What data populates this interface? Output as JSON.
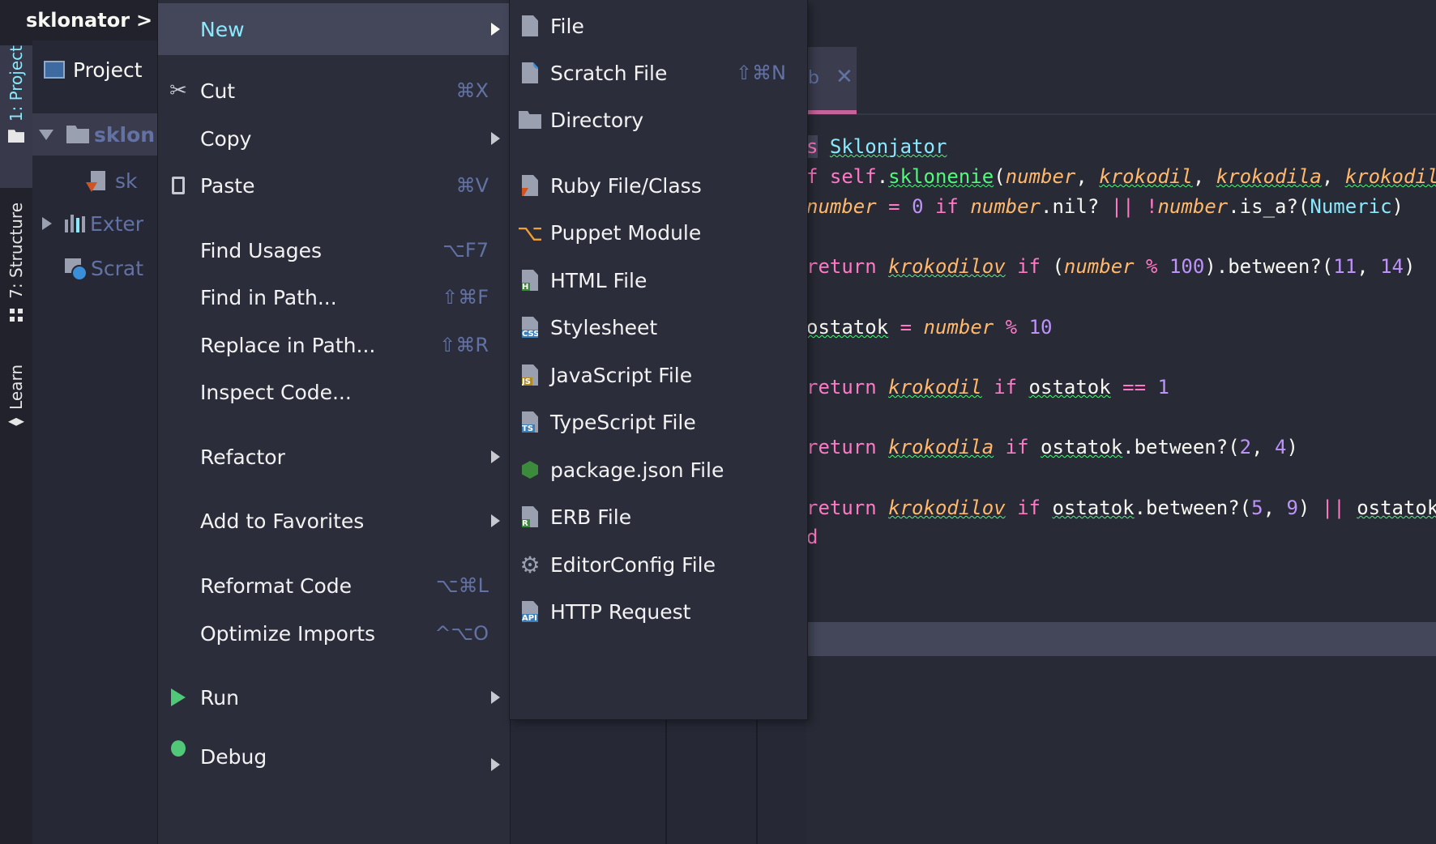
{
  "breadcrumb": {
    "project": "sklonator",
    "separator": ">"
  },
  "tool_strip": {
    "project_tab": "1: Project",
    "structure_tab": "7: Structure",
    "learn_tab": "Learn"
  },
  "project_panel": {
    "header": "Project",
    "root": "sklon",
    "file": "sk",
    "external": "Exter",
    "scratches": "Scrat"
  },
  "context_menu": {
    "items": [
      {
        "label": "New",
        "shortcut": "",
        "submenu": true,
        "selected": true
      },
      {
        "label": "Cut",
        "shortcut": "⌘X",
        "icon": "scissors-icon"
      },
      {
        "label": "Copy",
        "shortcut": "",
        "submenu": true
      },
      {
        "label": "Paste",
        "shortcut": "⌘V",
        "icon": "clipboard-icon"
      },
      {
        "label": "Find Usages",
        "shortcut": "⌥F7"
      },
      {
        "label": "Find in Path...",
        "shortcut": "⇧⌘F"
      },
      {
        "label": "Replace in Path...",
        "shortcut": "⇧⌘R"
      },
      {
        "label": "Inspect Code...",
        "shortcut": ""
      },
      {
        "label": "Refactor",
        "shortcut": "",
        "submenu": true
      },
      {
        "label": "Add to Favorites",
        "shortcut": "",
        "submenu": true
      },
      {
        "label": "Reformat Code",
        "shortcut": "⌥⌘L"
      },
      {
        "label": "Optimize Imports",
        "shortcut": "^⌥O"
      },
      {
        "label": "Run",
        "shortcut": "",
        "submenu": true,
        "icon": "run-icon"
      },
      {
        "label": "Debug",
        "shortcut": "",
        "submenu": true,
        "icon": "debug-icon"
      }
    ]
  },
  "new_submenu": {
    "items": [
      {
        "label": "File",
        "shortcut": "",
        "icon": "file-icon"
      },
      {
        "label": "Scratch File",
        "shortcut": "⇧⌘N",
        "icon": "scratch-file-icon"
      },
      {
        "label": "Directory",
        "shortcut": "",
        "icon": "folder-icon"
      },
      {
        "label": "Ruby File/Class",
        "shortcut": "",
        "icon": "ruby-file-icon"
      },
      {
        "label": "Puppet Module",
        "shortcut": "",
        "icon": "puppet-icon"
      },
      {
        "label": "HTML File",
        "shortcut": "",
        "icon": "html-file-icon",
        "badge": "H"
      },
      {
        "label": "Stylesheet",
        "shortcut": "",
        "icon": "css-file-icon",
        "badge": "CSS"
      },
      {
        "label": "JavaScript File",
        "shortcut": "",
        "icon": "js-file-icon",
        "badge": "JS"
      },
      {
        "label": "TypeScript File",
        "shortcut": "",
        "icon": "ts-file-icon",
        "badge": "TS"
      },
      {
        "label": "package.json File",
        "shortcut": "",
        "icon": "nodejs-icon"
      },
      {
        "label": "ERB File",
        "shortcut": "",
        "icon": "erb-file-icon",
        "badge": "R"
      },
      {
        "label": "EditorConfig File",
        "shortcut": "",
        "icon": "gear-icon"
      },
      {
        "label": "HTTP Request",
        "shortcut": "",
        "icon": "api-file-icon",
        "badge": "API"
      }
    ]
  },
  "editor": {
    "tab_name": "b",
    "tab_close": "✕",
    "code": {
      "l1": [
        "s",
        "Sklonjator"
      ],
      "l2": [
        "f",
        "self",
        ".",
        "sklonenie",
        "(",
        "number",
        ", ",
        "krokodil",
        ", ",
        "krokodila",
        ", ",
        "krokodilo"
      ],
      "l3": [
        "number",
        " = ",
        "0",
        " if ",
        "number",
        ".nil? ",
        "||",
        " !",
        "number",
        ".is_a?(",
        "Numeric",
        ")"
      ],
      "l4": [
        "return",
        " ",
        "krokodilov",
        " if ",
        "(",
        "number",
        " % ",
        "100",
        ").between?(",
        "11",
        ", ",
        "14",
        ")"
      ],
      "l5": [
        "ostatok",
        " = ",
        "number",
        " % ",
        "10"
      ],
      "l6": [
        "return",
        " ",
        "krokodil",
        " if ",
        "ostatok",
        " == ",
        "1"
      ],
      "l7": [
        "return",
        " ",
        "krokodila",
        " if ",
        "ostatok",
        ".between?(",
        "2",
        ", ",
        "4",
        ")"
      ],
      "l8": [
        "return",
        " ",
        "krokodilov",
        " if ",
        "ostatok",
        ".between?(",
        "5",
        ", ",
        "9",
        ") ",
        "||",
        " ",
        "ostatok",
        "."
      ],
      "l9": [
        "d"
      ]
    }
  },
  "colors": {
    "accent": "#8be9fd",
    "keyword": "#ff79c6",
    "param": "#ffb86c",
    "number": "#bd93f9",
    "function": "#50fa7b",
    "menu_bg": "#2b2d3b",
    "selection": "#44475a"
  }
}
